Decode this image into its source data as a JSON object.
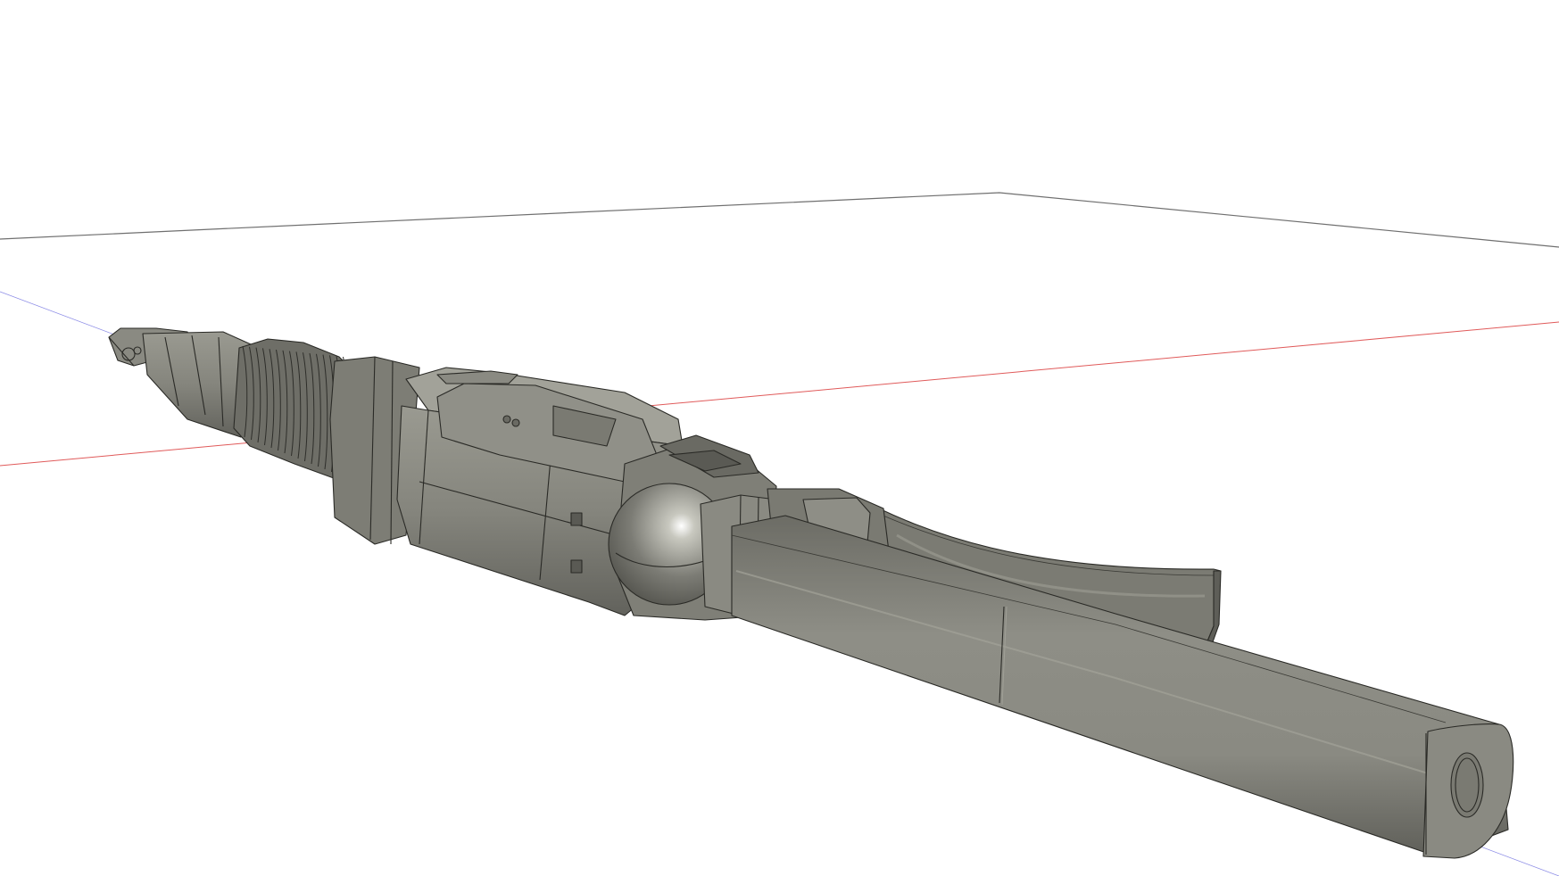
{
  "viewport": {
    "background": "#ffffff",
    "grid_color": "#c9c9c9",
    "grid_major_color": "#9a9a9a",
    "grid_edge_color": "#6f6f6f",
    "axis_x_color": "#e05a5a",
    "axis_y_color": "#7a7ae6",
    "model_color": "#8c8c84",
    "model_shade_color": "#6e6e67",
    "model_highlight_color": "#b5b5ab",
    "model_edge_color": "#2a2a26"
  },
  "model": {
    "description_icon": "3d-model-icon"
  }
}
